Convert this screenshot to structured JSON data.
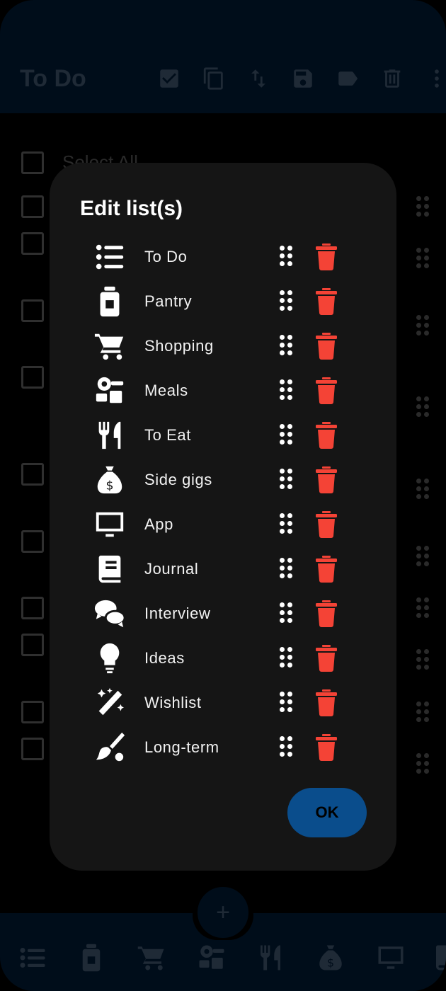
{
  "appbar": {
    "title": "To Do",
    "icons": [
      "check-box-icon",
      "copy-icon",
      "sort-icon",
      "save-icon",
      "label-icon",
      "delete-icon",
      "more-vert-icon"
    ]
  },
  "background_list": {
    "select_all_label": "Select All"
  },
  "dialog": {
    "title": "Edit list(s)",
    "ok_label": "OK",
    "items": [
      {
        "label": "To Do",
        "icon": "list-icon"
      },
      {
        "label": "Pantry",
        "icon": "jar-icon"
      },
      {
        "label": "Shopping",
        "icon": "cart-icon"
      },
      {
        "label": "Meals",
        "icon": "kitchen-icon"
      },
      {
        "label": "To Eat",
        "icon": "utensils-icon"
      },
      {
        "label": "Side gigs",
        "icon": "money-bag-icon"
      },
      {
        "label": "App",
        "icon": "monitor-icon"
      },
      {
        "label": "Journal",
        "icon": "book-icon"
      },
      {
        "label": "Interview",
        "icon": "chat-bubbles-icon"
      },
      {
        "label": "Ideas",
        "icon": "lightbulb-icon"
      },
      {
        "label": "Wishlist",
        "icon": "magic-wand-icon"
      },
      {
        "label": "Long-term",
        "icon": "paint-brush-icon"
      }
    ]
  },
  "fab": {
    "label": "+"
  },
  "colors": {
    "accent": "#0a4d8c",
    "delete": "#f44336",
    "dialog_bg": "#151515",
    "appbar_bg": "#000d1a"
  }
}
